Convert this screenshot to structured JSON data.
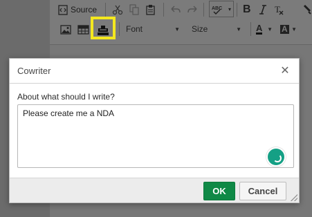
{
  "toolbar": {
    "source_label": "Source",
    "font_combo": "Font",
    "size_combo": "Size",
    "bold_label": "B",
    "text_color_label": "A",
    "bg_color_label": "A"
  },
  "dialog": {
    "title": "Cowriter",
    "prompt_label": "About what should I write?",
    "prompt_value": "Please create me a NDA",
    "ok_label": "OK",
    "cancel_label": "Cancel"
  },
  "colors": {
    "ok_button": "#0f8946",
    "highlight": "#f4e81f",
    "grammar_badge": "#15a085"
  }
}
